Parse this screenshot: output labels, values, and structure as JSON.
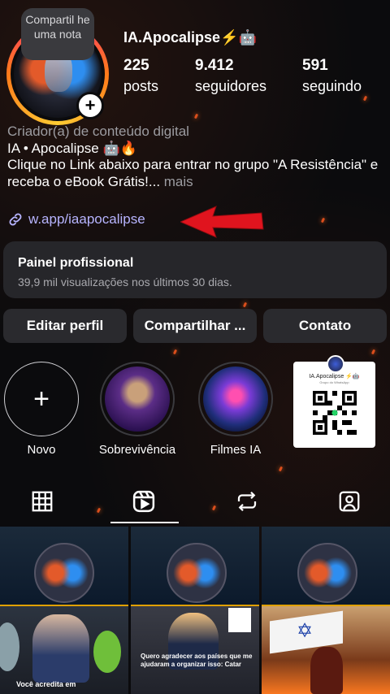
{
  "profile": {
    "note": "Compartil he uma nota",
    "username": "IA.Apocalipse",
    "username_emoji": "⚡🤖",
    "stats": [
      {
        "value": "225",
        "label": "posts"
      },
      {
        "value": "9.412",
        "label": "seguidores"
      },
      {
        "value": "591",
        "label": "seguindo"
      }
    ]
  },
  "bio": {
    "category": "Criador(a) de conteúdo digital",
    "line1": "IA • Apocalipse 🤖🔥",
    "line2": "Clique no Link abaixo para entrar no grupo \"A Resistência\" e",
    "line3": "receba o eBook Grátis!...",
    "more": " mais",
    "link": "w.app/iaapocalipse"
  },
  "panel": {
    "title": "Painel profissional",
    "subtitle": "39,9 mil visualizações nos últimos 30 dias."
  },
  "buttons": {
    "edit": "Editar perfil",
    "share": "Compartilhar ...",
    "contact": "Contato"
  },
  "highlights": [
    {
      "label": "Novo"
    },
    {
      "label": "Sobrevivência"
    },
    {
      "label": "Filmes IA"
    }
  ],
  "qr_card": {
    "name": "IA.Apocalipse ⚡🤖",
    "sub": "Grupo do WhatsApp"
  },
  "grid": {
    "captions": [
      "Você acredita em",
      "Quero agradecer aos países que me ajudaram a organizar isso: Catar"
    ]
  },
  "colors": {
    "accent_link": "#b7b4ff",
    "panel_bg": "#26262a",
    "arrow": "#e0141e"
  }
}
